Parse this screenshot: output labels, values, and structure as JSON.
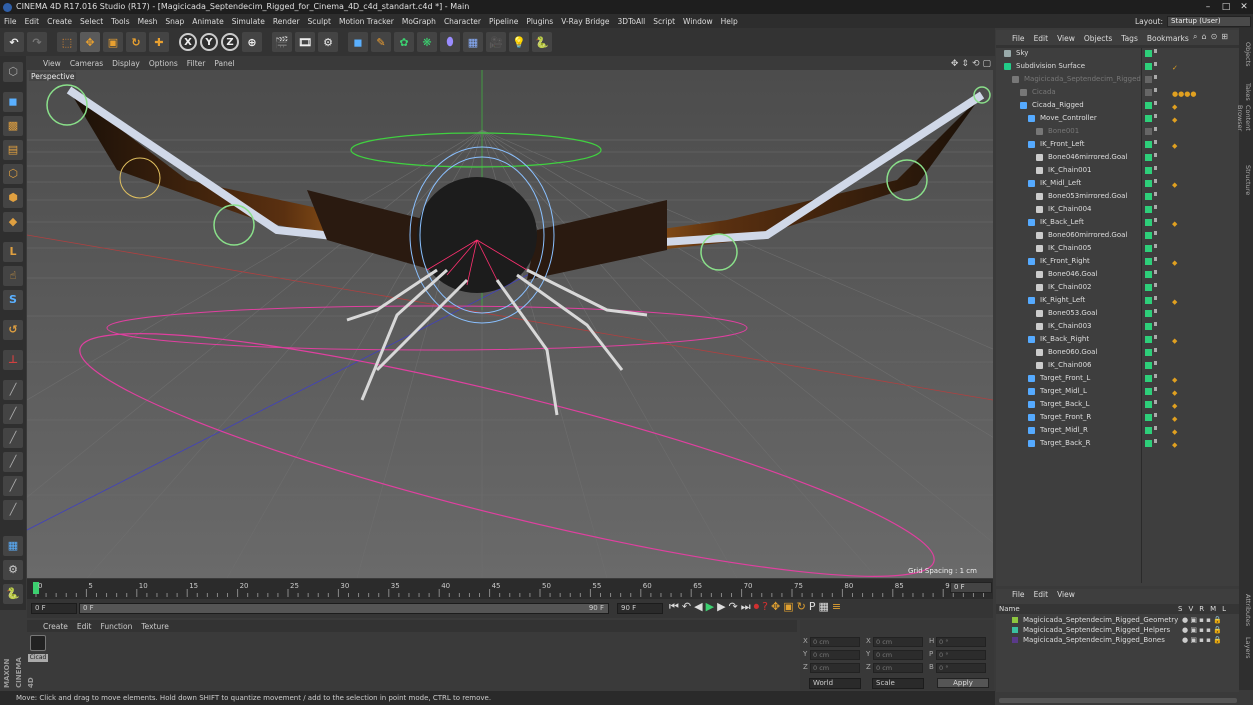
{
  "window": {
    "title": "CINEMA 4D R17.016 Studio (R17) - [Magicicada_Septendecim_Rigged_for_Cinema_4D_c4d_standart.c4d *] - Main",
    "controls": [
      "–",
      "□",
      "✕"
    ]
  },
  "menubar": {
    "items": [
      "File",
      "Edit",
      "Create",
      "Select",
      "Tools",
      "Mesh",
      "Snap",
      "Animate",
      "Simulate",
      "Render",
      "Sculpt",
      "Motion Tracker",
      "MoGraph",
      "Character",
      "Pipeline",
      "Plugins",
      "V-Ray Bridge",
      "3DToAll",
      "Script",
      "Window",
      "Help"
    ],
    "layout_label": "Layout:",
    "layout_value": "Startup (User)"
  },
  "toolbar": {
    "axis_x": "X",
    "axis_y": "Y",
    "axis_z": "Z"
  },
  "viewport": {
    "menu": [
      "View",
      "Cameras",
      "Display",
      "Options",
      "Filter",
      "Panel"
    ],
    "camera_label": "Perspective",
    "grid_spacing": "Grid Spacing : 1 cm"
  },
  "timeline": {
    "ticks": [
      "0",
      "5",
      "10",
      "15",
      "20",
      "25",
      "30",
      "35",
      "40",
      "45",
      "50",
      "55",
      "60",
      "65",
      "70",
      "75",
      "80",
      "85",
      "90"
    ],
    "current_frame": "0 F",
    "start_field": "0 F",
    "mid_field": "0 F",
    "end_field": "90 F",
    "end_field2": "90 F"
  },
  "materials": {
    "menu": [
      "Create",
      "Edit",
      "Function",
      "Texture"
    ],
    "items": [
      {
        "name": "Cicad"
      }
    ]
  },
  "coordinates": {
    "rows": [
      {
        "a": "X",
        "av": "0 cm",
        "b": "X",
        "bv": "0 cm",
        "c": "H",
        "cv": "0 °"
      },
      {
        "a": "Y",
        "av": "0 cm",
        "b": "Y",
        "bv": "0 cm",
        "c": "P",
        "cv": "0 °"
      },
      {
        "a": "Z",
        "av": "0 cm",
        "b": "Z",
        "bv": "0 cm",
        "c": "B",
        "cv": "0 °"
      }
    ],
    "mode": "World",
    "scale": "Scale",
    "apply": "Apply"
  },
  "status": "Move: Click and drag to move elements. Hold down SHIFT to quantize movement / add to the selection in point mode, CTRL to remove.",
  "branding": "MAXON CINEMA 4D",
  "objects": {
    "menu": [
      "File",
      "Edit",
      "View",
      "Objects",
      "Tags",
      "Bookmarks"
    ],
    "rows": [
      {
        "name": "Sky",
        "indent": 0,
        "icon": "#9aa",
        "dim": false,
        "tag": ""
      },
      {
        "name": "Subdivision Surface",
        "indent": 0,
        "icon": "#2c8",
        "dim": false,
        "tag": "✓"
      },
      {
        "name": "Magicicada_Septendecim_Rigged",
        "indent": 1,
        "icon": "#777",
        "dim": true,
        "tag": ""
      },
      {
        "name": "Cicada",
        "indent": 2,
        "icon": "#777",
        "dim": true,
        "tag": "●●●●"
      },
      {
        "name": "Cicada_Rigged",
        "indent": 2,
        "icon": "#5af",
        "dim": false,
        "tag": "◆"
      },
      {
        "name": "Move_Controller",
        "indent": 3,
        "icon": "#5af",
        "dim": false,
        "tag": "◆"
      },
      {
        "name": "Bone001",
        "indent": 4,
        "icon": "#777",
        "dim": true,
        "tag": ""
      },
      {
        "name": "IK_Front_Left",
        "indent": 3,
        "icon": "#5af",
        "dim": false,
        "tag": "◆"
      },
      {
        "name": "Bone046mirrored.Goal",
        "indent": 4,
        "icon": "#ccc",
        "dim": false,
        "tag": ""
      },
      {
        "name": "IK_Chain001",
        "indent": 4,
        "icon": "#ccc",
        "dim": false,
        "tag": ""
      },
      {
        "name": "IK_Midl_Left",
        "indent": 3,
        "icon": "#5af",
        "dim": false,
        "tag": "◆"
      },
      {
        "name": "Bone053mirrored.Goal",
        "indent": 4,
        "icon": "#ccc",
        "dim": false,
        "tag": ""
      },
      {
        "name": "IK_Chain004",
        "indent": 4,
        "icon": "#ccc",
        "dim": false,
        "tag": ""
      },
      {
        "name": "IK_Back_Left",
        "indent": 3,
        "icon": "#5af",
        "dim": false,
        "tag": "◆"
      },
      {
        "name": "Bone060mirrored.Goal",
        "indent": 4,
        "icon": "#ccc",
        "dim": false,
        "tag": ""
      },
      {
        "name": "IK_Chain005",
        "indent": 4,
        "icon": "#ccc",
        "dim": false,
        "tag": ""
      },
      {
        "name": "IK_Front_Right",
        "indent": 3,
        "icon": "#5af",
        "dim": false,
        "tag": "◆"
      },
      {
        "name": "Bone046.Goal",
        "indent": 4,
        "icon": "#ccc",
        "dim": false,
        "tag": ""
      },
      {
        "name": "IK_Chain002",
        "indent": 4,
        "icon": "#ccc",
        "dim": false,
        "tag": ""
      },
      {
        "name": "IK_Right_Left",
        "indent": 3,
        "icon": "#5af",
        "dim": false,
        "tag": "◆"
      },
      {
        "name": "Bone053.Goal",
        "indent": 4,
        "icon": "#ccc",
        "dim": false,
        "tag": ""
      },
      {
        "name": "IK_Chain003",
        "indent": 4,
        "icon": "#ccc",
        "dim": false,
        "tag": ""
      },
      {
        "name": "IK_Back_Right",
        "indent": 3,
        "icon": "#5af",
        "dim": false,
        "tag": "◆"
      },
      {
        "name": "Bone060.Goal",
        "indent": 4,
        "icon": "#ccc",
        "dim": false,
        "tag": ""
      },
      {
        "name": "IK_Chain006",
        "indent": 4,
        "icon": "#ccc",
        "dim": false,
        "tag": ""
      },
      {
        "name": "Target_Front_L",
        "indent": 3,
        "icon": "#5af",
        "dim": false,
        "tag": "◆"
      },
      {
        "name": "Target_Midl_L",
        "indent": 3,
        "icon": "#5af",
        "dim": false,
        "tag": "◆"
      },
      {
        "name": "Target_Back_L",
        "indent": 3,
        "icon": "#5af",
        "dim": false,
        "tag": "◆"
      },
      {
        "name": "Target_Front_R",
        "indent": 3,
        "icon": "#5af",
        "dim": false,
        "tag": "◆"
      },
      {
        "name": "Target_Midl_R",
        "indent": 3,
        "icon": "#5af",
        "dim": false,
        "tag": "◆"
      },
      {
        "name": "Target_Back_R",
        "indent": 3,
        "icon": "#5af",
        "dim": false,
        "tag": "◆"
      }
    ]
  },
  "layers": {
    "menu": [
      "File",
      "Edit",
      "View"
    ],
    "header": "Name",
    "cols": [
      "S",
      "V",
      "R",
      "M",
      "L"
    ],
    "rows": [
      {
        "name": "Magicicada_Septendecim_Rigged_Geometry",
        "color": "#8dc63f"
      },
      {
        "name": "Magicicada_Septendecim_Rigged_Helpers",
        "color": "#3ac0a0"
      },
      {
        "name": "Magicicada_Septendecim_Rigged_Bones",
        "color": "#5a3a8a"
      }
    ]
  },
  "right_tabs": [
    "Objects",
    "Takes",
    "Content Browser",
    "Structure",
    "Attributes",
    "Layers"
  ]
}
